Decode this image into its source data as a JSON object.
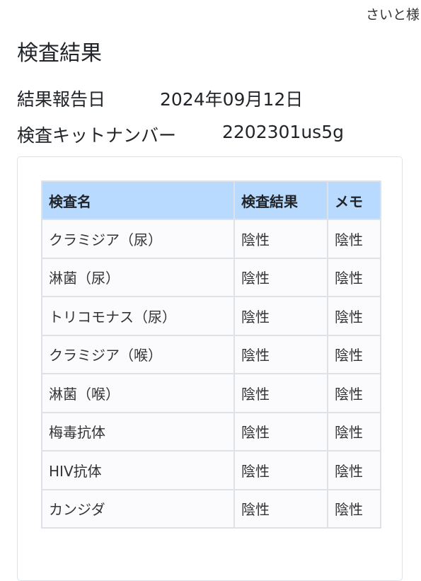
{
  "header": {
    "user_name": "さいと様"
  },
  "page": {
    "title": "検査結果"
  },
  "info": {
    "report_date_label": "結果報告日",
    "report_date_value": "2024年09月12日",
    "kit_number_label": "検査キットナンバー",
    "kit_number_value": "2202301us5g"
  },
  "table": {
    "columns": [
      "検査名",
      "検査結果",
      "メモ"
    ],
    "rows": [
      {
        "name": "クラミジア（尿）",
        "result": "陰性",
        "memo": "陰性"
      },
      {
        "name": "淋菌（尿）",
        "result": "陰性",
        "memo": "陰性"
      },
      {
        "name": "トリコモナス（尿）",
        "result": "陰性",
        "memo": "陰性"
      },
      {
        "name": "クラミジア（喉）",
        "result": "陰性",
        "memo": "陰性"
      },
      {
        "name": "淋菌（喉）",
        "result": "陰性",
        "memo": "陰性"
      },
      {
        "name": "梅毒抗体",
        "result": "陰性",
        "memo": "陰性"
      },
      {
        "name": "HIV抗体",
        "result": "陰性",
        "memo": "陰性"
      },
      {
        "name": "カンジダ",
        "result": "陰性",
        "memo": "陰性"
      }
    ]
  },
  "colors": {
    "header_bg": "#b8daff",
    "border": "#dee2e6",
    "text": "#212529"
  }
}
